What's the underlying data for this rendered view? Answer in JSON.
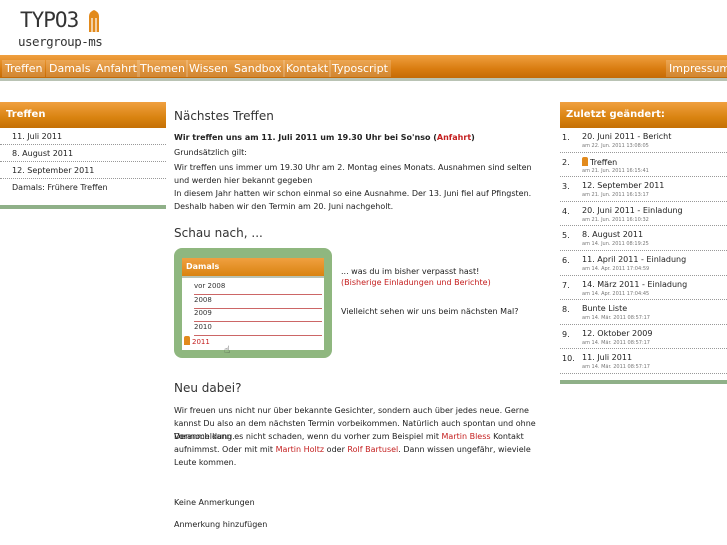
{
  "logo": {
    "line1": "TYPO3",
    "line2": "usergroup-ms"
  },
  "topnav": {
    "items": [
      "Treffen",
      "Damals",
      "Anfahrt",
      "Themen",
      "Wissen",
      "Sandbox",
      "Kontakt",
      "Typoscript"
    ],
    "right_item": "Impressum"
  },
  "left_sidebar": {
    "title": "Treffen",
    "items": [
      "11. Juli 2011",
      "8. August 2011",
      "12. September 2011",
      "Damals: Frühere Treffen"
    ]
  },
  "main": {
    "title": "Nächstes Treffen",
    "intro_bold": "Wir treffen uns am 11. Juli 2011 um 19.30 Uhr bei So'nso (",
    "intro_link": "Anfahrt",
    "intro_end": ")",
    "p1": "Grundsätzlich gilt:",
    "p2": "Wir treffen uns immer um 19.30 Uhr am 2. Montag eines Monats. Ausnahmen sind selten und werden hier bekannt gegeben",
    "p3": "In diesem Jahr hatten wir schon einmal so eine Ausnahme. Der 13. Juni fiel auf Pfingsten. Deshalb haben wir den Termin am 20. Juni nachgeholt.",
    "schau_title": "Schau nach, ...",
    "damals_box": {
      "title": "Damals",
      "rows": [
        "vor 2008",
        "2008",
        "2009",
        "2010",
        "2011"
      ]
    },
    "was_du": "... was du im bisher verpasst hast!",
    "was_link": "(Bisherige Einladungen und Berichte)",
    "vielleicht": "Vielleicht sehen wir uns beim nächsten Mal?",
    "neu_title": "Neu dabei?",
    "p4": "Wir freuen uns nicht nur über bekannte Gesichter, sondern auch über jedes neue. Gerne kannst Du also an dem nächsten Termin vorbeikommen. Natürlich auch spontan und ohne Voranmeldung.",
    "p5_a": "Dennoch kann es nicht schaden, wenn du vorher zum Beispiel mit ",
    "p5_link1": "Martin Bless",
    "p5_b": " Kontakt aufnimmst. Oder mit mit ",
    "p5_link2": "Martin Holtz",
    "p5_c": " oder ",
    "p5_link3": "Rolf Bartusel",
    "p5_d": ". Dann wissen ungefähr, wieviele Leute kommen.",
    "keine": "Keine Anmerkungen",
    "anmerkung": "Anmerkung hinzufügen"
  },
  "right_sidebar": {
    "title": "Zuletzt geändert:",
    "items": [
      {
        "n": "1.",
        "t": "20. Juni 2011 - Bericht",
        "d": "am 22. Jun. 2011 13:08:05"
      },
      {
        "n": "2.",
        "t": "Treffen",
        "d": "am 21. Jun. 2011 16:15:41"
      },
      {
        "n": "3.",
        "t": "12. September 2011",
        "d": "am 21. Jun. 2011 16:13:17"
      },
      {
        "n": "4.",
        "t": "20. Juni 2011 - Einladung",
        "d": "am 21. Jun. 2011 16:10:32"
      },
      {
        "n": "5.",
        "t": "8. August 2011",
        "d": "am 14. Jun. 2011 08:19:25"
      },
      {
        "n": "6.",
        "t": "11. April 2011 - Einladung",
        "d": "am 14. Apr. 2011 17:04:59"
      },
      {
        "n": "7.",
        "t": "14. März 2011 - Einladung",
        "d": "am 14. Apr. 2011 17:04:45"
      },
      {
        "n": "8.",
        "t": "Bunte Liste",
        "d": "am 14. Mär. 2011 08:57:17"
      },
      {
        "n": "9.",
        "t": "12. Oktober 2009",
        "d": "am 14. Mär. 2011 08:57:17"
      },
      {
        "n": "10.",
        "t": "11. Juli 2011",
        "d": "am 14. Mär. 2011 08:57:17"
      }
    ]
  }
}
